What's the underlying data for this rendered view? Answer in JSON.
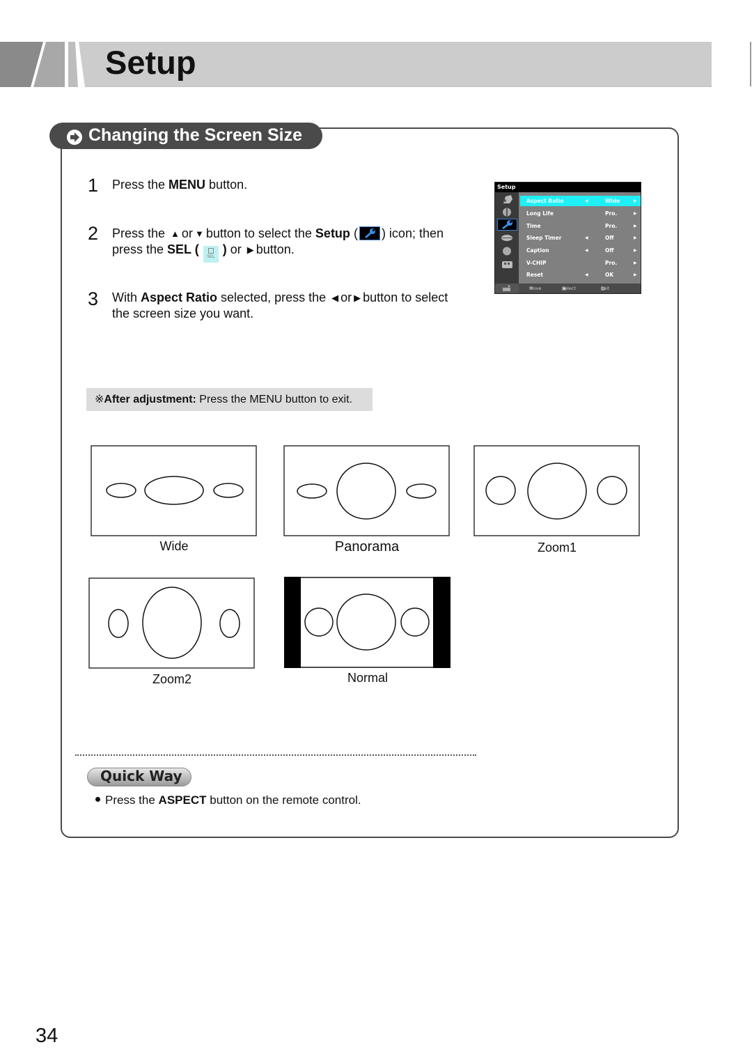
{
  "header": {
    "title": "Setup"
  },
  "section": {
    "title": "Changing the Screen Size",
    "icon": "arrow-circle-right-icon"
  },
  "steps": [
    {
      "number": "1",
      "parts": [
        "Press the ",
        "MENU",
        " button."
      ]
    },
    {
      "number": "2",
      "line1": [
        "Press the ",
        "or",
        "button to select the ",
        "Setup",
        " (",
        ") icon; then"
      ],
      "line2": [
        "press the ",
        "SEL (",
        ")",
        " or ",
        "button."
      ],
      "icons": [
        "up-triangle-icon",
        "down-triangle-icon",
        "setup-wrench-icon",
        "sel-button-icon",
        "right-triangle-icon"
      ],
      "sel_icon_label": "SEL"
    },
    {
      "number": "3",
      "line1": [
        "With ",
        "Aspect Ratio",
        " selected, press the ",
        "or",
        "button to select"
      ],
      "line2": "the screen size you want.",
      "icons": [
        "left-triangle-icon",
        "right-triangle-icon"
      ]
    }
  ],
  "osd_menu": {
    "title": "Setup",
    "side_icons": [
      "picture-icon",
      "sound-icon",
      "setup-wrench-icon",
      "lips-icon",
      "ball-icon",
      "input-icon",
      "extra-icon"
    ],
    "active_side_index": 2,
    "rows": [
      {
        "label": "Aspect Ratio",
        "left_arrow": true,
        "value": "Wide",
        "active": true
      },
      {
        "label": "Long Life",
        "left_arrow": false,
        "value": "Pro.",
        "active": false
      },
      {
        "label": "Time",
        "left_arrow": false,
        "value": "Pro.",
        "active": false
      },
      {
        "label": "Sleep Timer",
        "left_arrow": true,
        "value": "Off",
        "active": false
      },
      {
        "label": "Caption",
        "left_arrow": true,
        "value": "Off",
        "active": false
      },
      {
        "label": "V-CHIP",
        "left_arrow": false,
        "value": "Pro.",
        "active": false
      },
      {
        "label": "Reset",
        "left_arrow": true,
        "value": "OK",
        "active": false
      }
    ],
    "footer": {
      "move": "Move",
      "select": "Select",
      "exit": "Exit"
    },
    "colors": {
      "highlight": "#1ff0f5",
      "active_icon_border": "#3a7fd6"
    }
  },
  "note": {
    "symbol": "※",
    "bold": "After adjustment:",
    "text": " Press the MENU button to exit."
  },
  "aspect_modes": [
    {
      "label": "Wide"
    },
    {
      "label": "Panorama"
    },
    {
      "label": "Zoom1"
    },
    {
      "label": "Zoom2"
    },
    {
      "label": "Normal"
    }
  ],
  "quick_way": {
    "title": "Quick Way",
    "parts": [
      "Press the ",
      "ASPECT",
      " button on the remote control."
    ]
  },
  "page_number": "34"
}
